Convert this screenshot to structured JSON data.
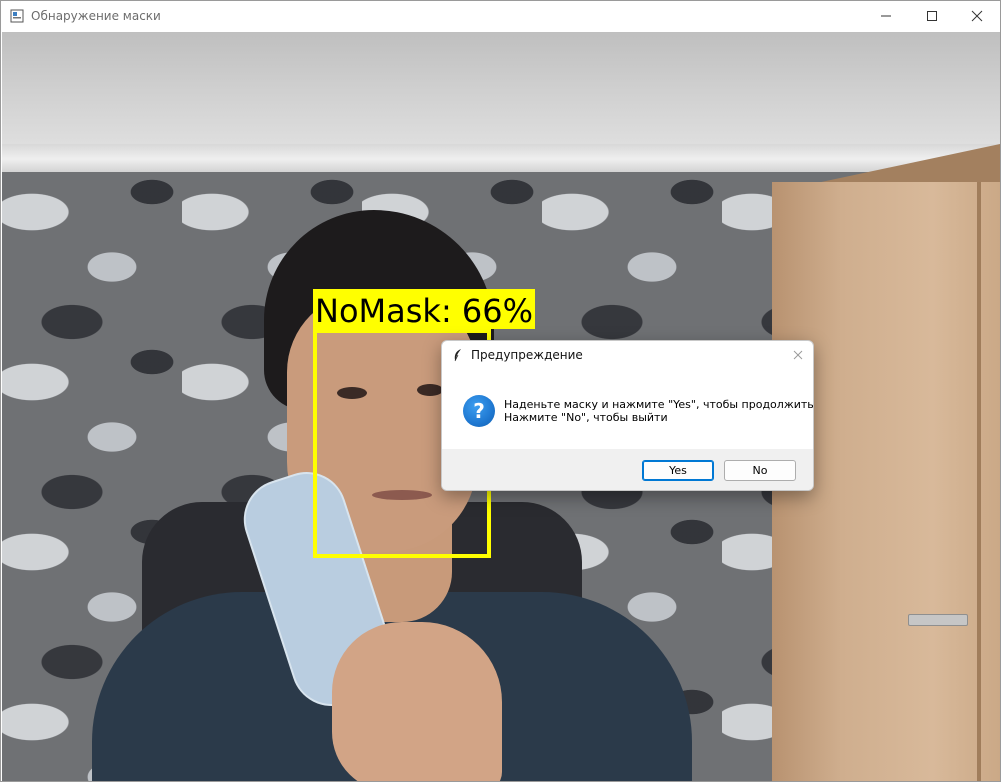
{
  "window": {
    "title": "Обнаружение маски",
    "controls": [
      "minimize-icon",
      "maximize-icon",
      "close-icon"
    ]
  },
  "video": {
    "detection": {
      "label": "NoMask: 66%",
      "box_color": "#ffff00",
      "class": "NoMask",
      "confidence_percent": 66
    }
  },
  "dialog": {
    "title": "Предупреждение",
    "icon": "question-icon",
    "message_line1": "Наденьте маску и нажмите \"Yes\", чтобы продолжить",
    "message_line2": "Нажмите \"No\", чтобы выйти",
    "yes_label": "Yes",
    "no_label": "No",
    "accent": "#0078d4"
  }
}
